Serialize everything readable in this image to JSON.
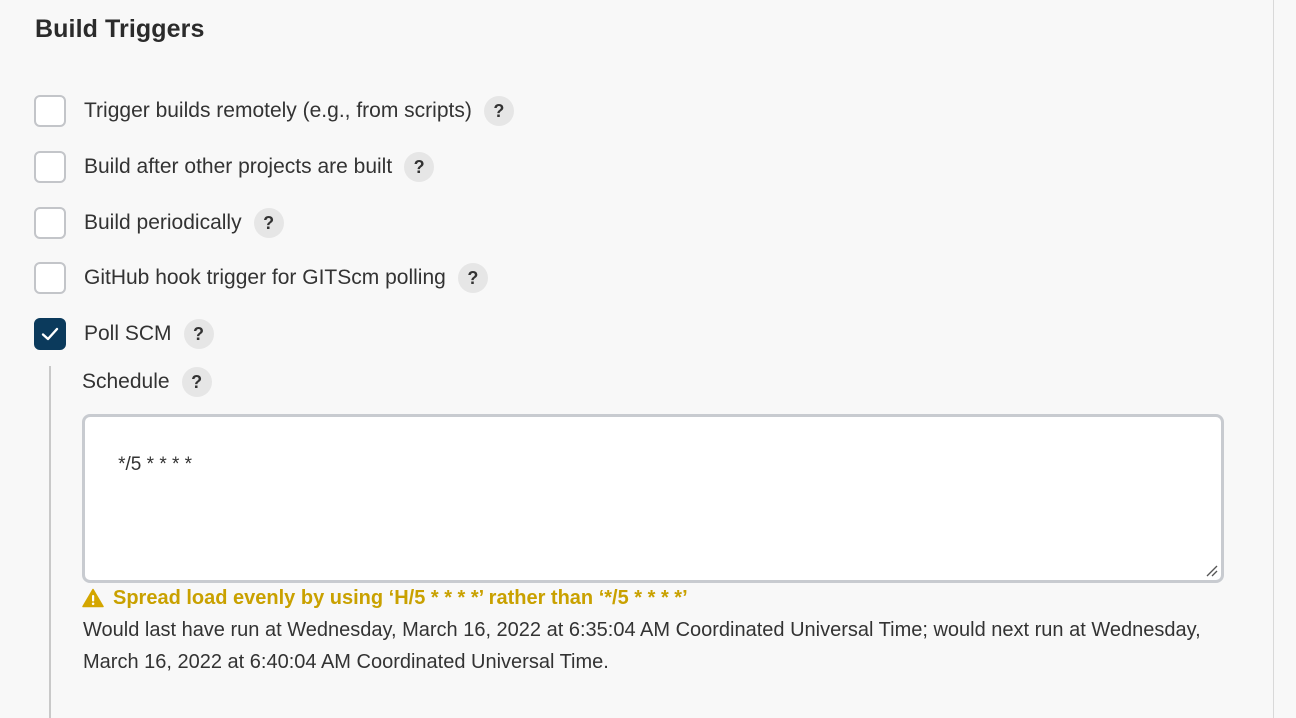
{
  "section": {
    "title": "Build Triggers"
  },
  "triggers": [
    {
      "label": "Trigger builds remotely (e.g., from scripts)",
      "checked": false
    },
    {
      "label": "Build after other projects are built",
      "checked": false
    },
    {
      "label": "Build periodically",
      "checked": false
    },
    {
      "label": "GitHub hook trigger for GITScm polling",
      "checked": false
    },
    {
      "label": "Poll SCM",
      "checked": true
    }
  ],
  "help_icon_text": "?",
  "poll_scm": {
    "schedule_label": "Schedule",
    "schedule_value": "*/5 * * * *",
    "warning": "Spread load evenly by using ‘H/5 * * * *’ rather than ‘*/5 * * * *’",
    "info": "Would last have run at Wednesday, March 16, 2022 at 6:35:04 AM Coordinated Universal Time; would next run at Wednesday, March 16, 2022 at 6:40:04 AM Coordinated Universal Time."
  },
  "colors": {
    "checked": "#0b3a5c",
    "warning": "#c9a100",
    "help_bg": "#e6e6e6"
  },
  "icons": {
    "checkmark": "checkmark-icon",
    "help": "help-icon",
    "warning": "warning-icon",
    "resize": "resize-grip-icon"
  }
}
